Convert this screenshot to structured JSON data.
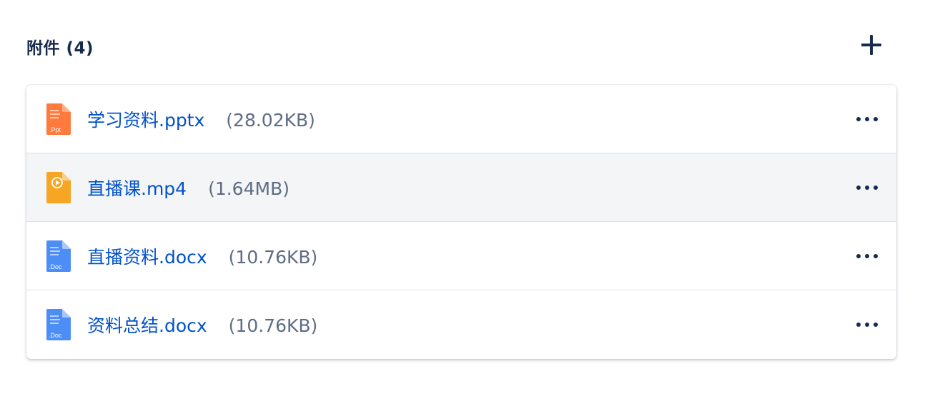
{
  "attachments": {
    "title": "附件 (4)",
    "add_icon": "plus-icon",
    "files": [
      {
        "name": "学习资料.pptx",
        "size": "(28.02KB)",
        "type": "ppt",
        "icon_label": ".Ppt",
        "icon_color": "#ff7a3d",
        "more_icon": "more-horizontal-icon"
      },
      {
        "name": "直播课.mp4",
        "size": "(1.64MB)",
        "type": "video",
        "icon_label": "",
        "icon_color": "#f6a623",
        "more_icon": "more-horizontal-icon"
      },
      {
        "name": "直播资料.docx",
        "size": "(10.76KB)",
        "type": "doc",
        "icon_label": ".Doc",
        "icon_color": "#4c8df6",
        "more_icon": "more-horizontal-icon"
      },
      {
        "name": "资料总结.docx",
        "size": "(10.76KB)",
        "type": "doc",
        "icon_label": ".Doc",
        "icon_color": "#4c8df6",
        "more_icon": "more-horizontal-icon"
      }
    ]
  }
}
